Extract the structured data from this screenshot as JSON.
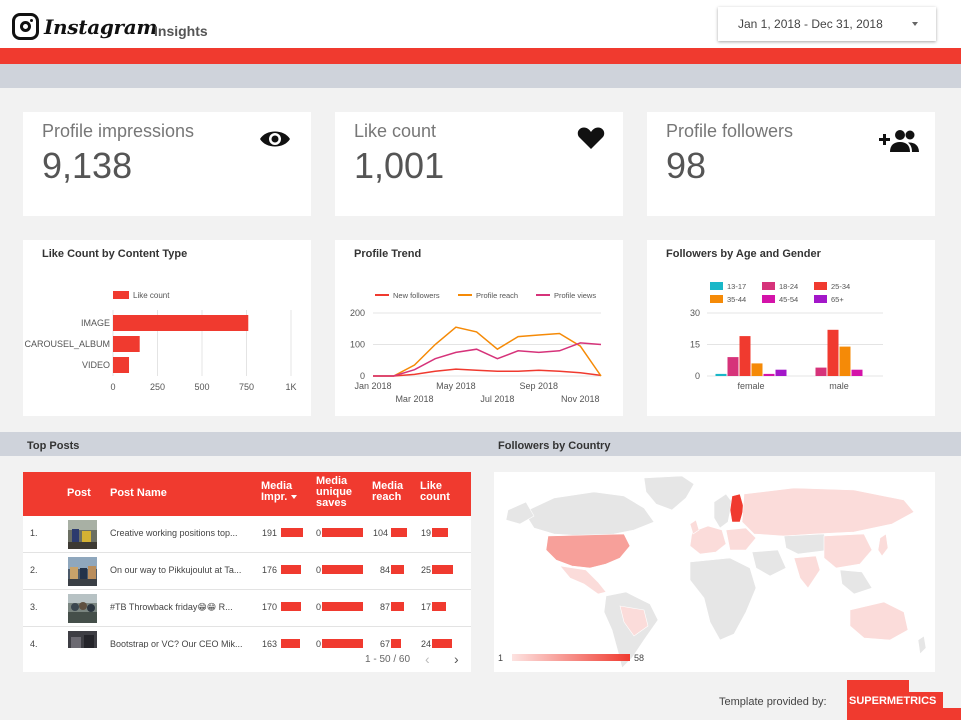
{
  "header": {
    "logo_text": "Instagram",
    "page_title": "Insights",
    "date_range": "Jan 1, 2018 - Dec 31, 2018"
  },
  "kpis": [
    {
      "label": "Profile impressions",
      "value": "9,138",
      "icon": "eye-icon"
    },
    {
      "label": "Like count",
      "value": "1,001",
      "icon": "heart-icon"
    },
    {
      "label": "Profile followers",
      "value": "98",
      "icon": "add-people-icon"
    }
  ],
  "colors": {
    "accent": "#f03a2f",
    "band": "#cfd3db",
    "orange": "#f58a07",
    "magenta": "#d6337a",
    "teal": "#19b7c8",
    "purple": "#a317c9",
    "map_low": "#fbdcda",
    "map_mid": "#f7a09a",
    "map_high": "#f03a2f"
  },
  "chart_data": [
    {
      "type": "bar",
      "orientation": "horizontal",
      "title": "Like Count by Content Type",
      "legend": [
        "Like count"
      ],
      "legend_placement": "top",
      "categories": [
        "IMAGE",
        "CAROUSEL_ALBUM",
        "VIDEO"
      ],
      "values": [
        760,
        150,
        90
      ],
      "xlim": [
        0,
        1000
      ],
      "ticks": [
        "0",
        "250",
        "500",
        "750",
        "1K"
      ],
      "grid": true
    },
    {
      "type": "line",
      "title": "Profile Trend",
      "legend_placement": "top",
      "x": [
        "Jan 2018",
        "Feb 2018",
        "Mar 2018",
        "Apr 2018",
        "May 2018",
        "Jun 2018",
        "Jul 2018",
        "Aug 2018",
        "Sep 2018",
        "Oct 2018",
        "Nov 2018",
        "Dec 2018"
      ],
      "x_tick_labels_top": [
        "Jan 2018",
        "May 2018",
        "Sep 2018"
      ],
      "x_tick_labels_bottom": [
        "Mar 2018",
        "Jul 2018",
        "Nov 2018"
      ],
      "ylim": [
        0,
        200
      ],
      "y_ticks": [
        "0",
        "100",
        "200"
      ],
      "series": [
        {
          "name": "New followers",
          "color": "#f03a2f",
          "values": [
            0,
            0,
            5,
            15,
            22,
            18,
            15,
            15,
            18,
            15,
            10,
            2
          ]
        },
        {
          "name": "Profile reach",
          "color": "#f58a07",
          "values": [
            0,
            0,
            35,
            100,
            155,
            140,
            85,
            125,
            130,
            135,
            95,
            0
          ]
        },
        {
          "name": "Profile views",
          "color": "#d6337a",
          "values": [
            0,
            0,
            20,
            55,
            75,
            85,
            55,
            80,
            75,
            80,
            105,
            100
          ]
        }
      ]
    },
    {
      "type": "bar",
      "title": "Followers by Age and Gender",
      "legend_placement": "top",
      "categories": [
        "female",
        "male"
      ],
      "ylim": [
        0,
        30
      ],
      "y_ticks": [
        "0",
        "15",
        "30"
      ],
      "series": [
        {
          "name": "13-17",
          "color": "#19b7c8",
          "values": [
            1,
            0
          ]
        },
        {
          "name": "18-24",
          "color": "#d6337a",
          "values": [
            9,
            4
          ]
        },
        {
          "name": "25-34",
          "color": "#f03a2f",
          "values": [
            19,
            22
          ]
        },
        {
          "name": "35-44",
          "color": "#f58a07",
          "values": [
            6,
            14
          ]
        },
        {
          "name": "45-54",
          "color": "#d413a9",
          "values": [
            1,
            3
          ]
        },
        {
          "name": "65+",
          "color": "#a317c9",
          "values": [
            3,
            0
          ]
        }
      ]
    }
  ],
  "top_posts": {
    "section_title": "Top Posts",
    "columns": {
      "post": "Post",
      "post_name": "Post Name",
      "impr": "Media Impr.",
      "saves": "Media unique saves",
      "reach": "Media reach",
      "likes": "Like count"
    },
    "rows": [
      {
        "num": "1.",
        "name": "Creative working positions top...",
        "impr": "191",
        "saves": "0",
        "reach": "104",
        "likes": "19",
        "impr_frac": 1.0,
        "saves_frac": 1.0,
        "reach_frac": 1.0,
        "likes_frac": 0.76
      },
      {
        "num": "2.",
        "name": "On our way to Pikkujoulut at Ta...",
        "impr": "176",
        "saves": "0",
        "reach": "84",
        "likes": "25",
        "impr_frac": 0.92,
        "saves_frac": 1.0,
        "reach_frac": 0.81,
        "likes_frac": 1.0
      },
      {
        "num": "3.",
        "name": "#TB Throwback friday😁😁 R...",
        "impr": "170",
        "saves": "0",
        "reach": "87",
        "likes": "17",
        "impr_frac": 0.89,
        "saves_frac": 1.0,
        "reach_frac": 0.84,
        "likes_frac": 0.68
      },
      {
        "num": "4.",
        "name": "Bootstrap or VC? Our CEO Mik...",
        "impr": "163",
        "saves": "0",
        "reach": "67",
        "likes": "24",
        "impr_frac": 0.85,
        "saves_frac": 1.0,
        "reach_frac": 0.64,
        "likes_frac": 0.96
      }
    ],
    "pagination": "1 - 50 / 60"
  },
  "followers_map": {
    "section_title": "Followers by Country",
    "legend_min": "1",
    "legend_max": "58"
  },
  "footer": {
    "template_text": "Template provided by:",
    "brand": "SUPERMETRICS",
    "tm": "TM"
  }
}
